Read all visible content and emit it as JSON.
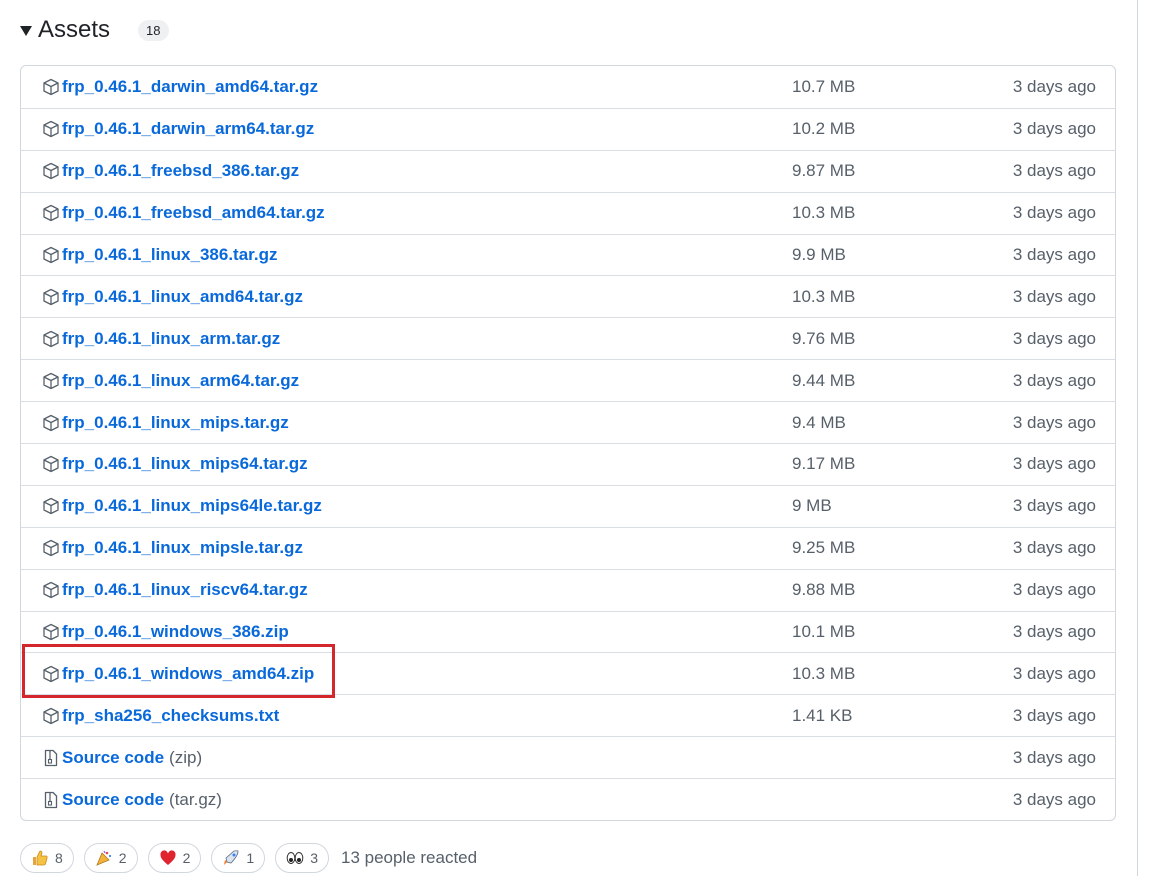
{
  "assets": {
    "title": "Assets",
    "count": "18",
    "rows": [
      {
        "name": "frp_0.46.1_darwin_amd64.tar.gz",
        "size": "10.7 MB",
        "date": "3 days ago"
      },
      {
        "name": "frp_0.46.1_darwin_arm64.tar.gz",
        "size": "10.2 MB",
        "date": "3 days ago"
      },
      {
        "name": "frp_0.46.1_freebsd_386.tar.gz",
        "size": "9.87 MB",
        "date": "3 days ago"
      },
      {
        "name": "frp_0.46.1_freebsd_amd64.tar.gz",
        "size": "10.3 MB",
        "date": "3 days ago"
      },
      {
        "name": "frp_0.46.1_linux_386.tar.gz",
        "size": "9.9 MB",
        "date": "3 days ago"
      },
      {
        "name": "frp_0.46.1_linux_amd64.tar.gz",
        "size": "10.3 MB",
        "date": "3 days ago"
      },
      {
        "name": "frp_0.46.1_linux_arm.tar.gz",
        "size": "9.76 MB",
        "date": "3 days ago"
      },
      {
        "name": "frp_0.46.1_linux_arm64.tar.gz",
        "size": "9.44 MB",
        "date": "3 days ago"
      },
      {
        "name": "frp_0.46.1_linux_mips.tar.gz",
        "size": "9.4 MB",
        "date": "3 days ago"
      },
      {
        "name": "frp_0.46.1_linux_mips64.tar.gz",
        "size": "9.17 MB",
        "date": "3 days ago"
      },
      {
        "name": "frp_0.46.1_linux_mips64le.tar.gz",
        "size": "9 MB",
        "date": "3 days ago"
      },
      {
        "name": "frp_0.46.1_linux_mipsle.tar.gz",
        "size": "9.25 MB",
        "date": "3 days ago"
      },
      {
        "name": "frp_0.46.1_linux_riscv64.tar.gz",
        "size": "9.88 MB",
        "date": "3 days ago"
      },
      {
        "name": "frp_0.46.1_windows_386.zip",
        "size": "10.1 MB",
        "date": "3 days ago"
      },
      {
        "name": "frp_0.46.1_windows_amd64.zip",
        "size": "10.3 MB",
        "date": "3 days ago"
      },
      {
        "name": "frp_sha256_checksums.txt",
        "size": "1.41 KB",
        "date": "3 days ago"
      }
    ],
    "source_rows": [
      {
        "name": "Source code",
        "ext": "(zip)",
        "date": "3 days ago"
      },
      {
        "name": "Source code",
        "ext": "(tar.gz)",
        "date": "3 days ago"
      }
    ]
  },
  "reactions": {
    "items": [
      {
        "icon": "thumbs-up-icon",
        "count": "8"
      },
      {
        "icon": "party-popper-icon",
        "count": "2"
      },
      {
        "icon": "heart-icon",
        "count": "2"
      },
      {
        "icon": "rocket-icon",
        "count": "1"
      },
      {
        "icon": "eyes-icon",
        "count": "3"
      }
    ],
    "summary": "13 people reacted"
  },
  "colors": {
    "link": "#0969da",
    "highlight": "#d3262d",
    "muted": "#57606a"
  }
}
